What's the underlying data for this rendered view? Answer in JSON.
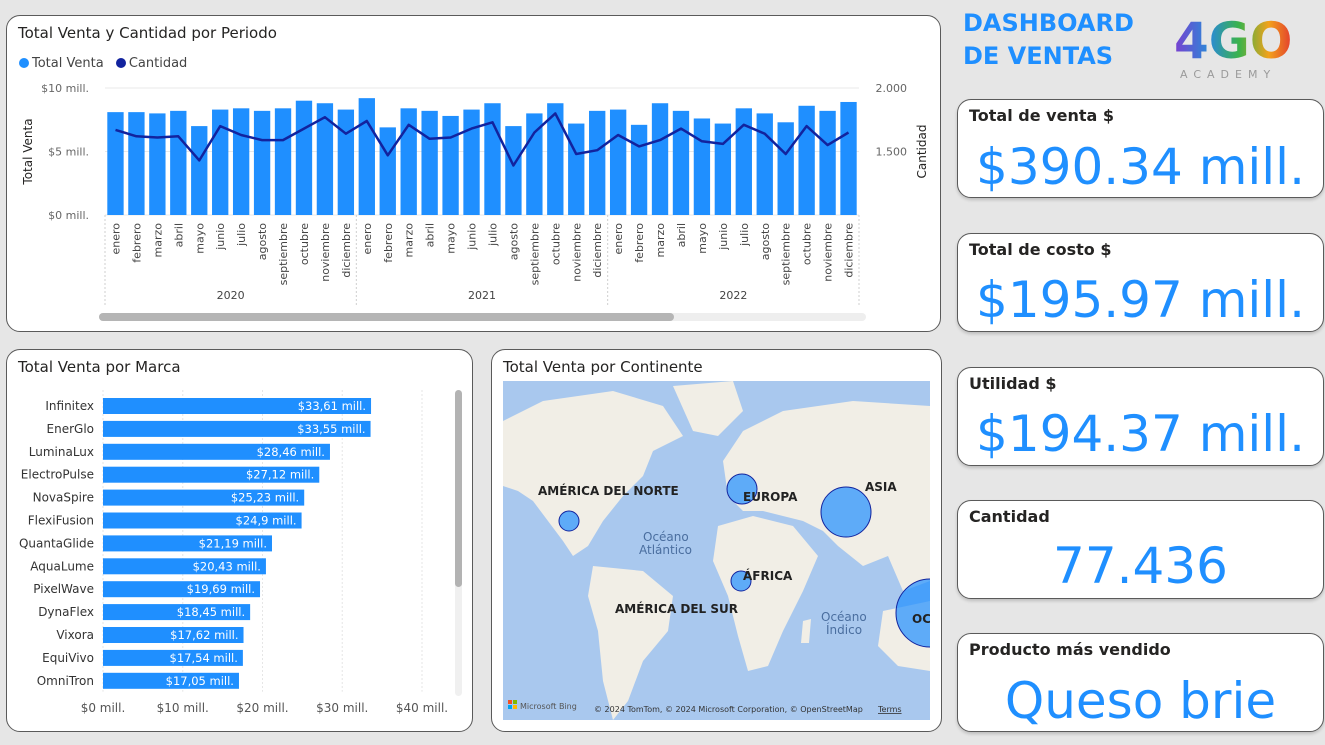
{
  "header": {
    "title_line1": "DASHBOARD",
    "title_line2": "DE VENTAS",
    "logo_text": "4GO",
    "logo_sub": "ACADEMY"
  },
  "colors": {
    "accent": "#1f8fff",
    "line": "#12239e"
  },
  "combo": {
    "title": "Total Venta y Cantidad por Periodo",
    "legend": [
      "Total Venta",
      "Cantidad"
    ]
  },
  "chart_data": [
    {
      "type": "bar+line",
      "title": "Total Venta y Cantidad por Periodo",
      "ylabel": "Total Venta",
      "y2label": "Cantidad",
      "ylim": [
        0,
        10
      ],
      "y2lim": [
        1000,
        2000
      ],
      "yticks": [
        "$0 mill.",
        "$5 mill.",
        "$10 mill."
      ],
      "y2ticks": [
        "1.500",
        "2.000"
      ],
      "years": [
        "2020",
        "2021",
        "2022"
      ],
      "months": [
        "enero",
        "febrero",
        "marzo",
        "abril",
        "mayo",
        "junio",
        "julio",
        "agosto",
        "septiembre",
        "octubre",
        "noviembre",
        "diciembre"
      ],
      "series": [
        {
          "name": "Total Venta",
          "values": [
            8.1,
            8.1,
            8.0,
            8.2,
            7.0,
            8.3,
            8.4,
            8.2,
            8.4,
            9.0,
            8.8,
            8.3,
            9.2,
            6.9,
            8.4,
            8.2,
            7.8,
            8.3,
            8.8,
            7.0,
            8.0,
            8.8,
            7.2,
            8.2,
            8.3,
            7.1,
            8.8,
            8.2,
            7.6,
            7.2,
            8.4,
            8.0,
            7.3,
            8.6,
            8.2,
            8.9
          ]
        },
        {
          "name": "Cantidad",
          "values": [
            1670,
            1620,
            1610,
            1620,
            1430,
            1700,
            1630,
            1590,
            1590,
            1680,
            1770,
            1640,
            1740,
            1470,
            1710,
            1600,
            1610,
            1680,
            1730,
            1390,
            1650,
            1800,
            1480,
            1510,
            1630,
            1540,
            1590,
            1680,
            1580,
            1560,
            1710,
            1640,
            1480,
            1700,
            1550,
            1650
          ]
        }
      ]
    },
    {
      "type": "bar",
      "title": "Total Venta por Marca",
      "categories": [
        "Infinitex",
        "EnerGlo",
        "LuminaLux",
        "ElectroPulse",
        "NovaSpire",
        "FlexiFusion",
        "QuantaGlide",
        "AquaLume",
        "PixelWave",
        "DynaFlex",
        "Vixora",
        "EquiVivo",
        "OmniTron"
      ],
      "values": [
        33.61,
        33.55,
        28.46,
        27.12,
        25.23,
        24.9,
        21.19,
        20.43,
        19.69,
        18.45,
        17.62,
        17.54,
        17.05
      ],
      "labels": [
        "$33,61 mill.",
        "$33,55 mill.",
        "$28,46 mill.",
        "$27,12 mill.",
        "$25,23 mill.",
        "$24,9 mill.",
        "$21,19 mill.",
        "$20,43 mill.",
        "$19,69 mill.",
        "$18,45 mill.",
        "$17,62 mill.",
        "$17,54 mill.",
        "$17,05 mill."
      ],
      "xlim": [
        0,
        40
      ],
      "xticks": [
        "$0 mill.",
        "$10 mill.",
        "$20 mill.",
        "$30 mill.",
        "$40 mill."
      ]
    }
  ],
  "brands": {
    "title": "Total Venta por Marca"
  },
  "map": {
    "title": "Total Venta por Continente",
    "labels": {
      "na": "AMÉRICA DEL NORTE",
      "eu": "EUROPA",
      "as": "ASIA",
      "af": "ÁFRICA",
      "sa": "AMÉRICA DEL SUR",
      "oc": "OCE"
    },
    "oceans": {
      "atl1": "Océano",
      "atl2": "Atlántico",
      "ind1": "Océano",
      "ind2": "Índico"
    },
    "footer_brand": "Microsoft Bing",
    "copyright": "© 2024 TomTom, © 2024 Microsoft Corporation, © OpenStreetMap",
    "terms": "Terms"
  },
  "kpis": [
    {
      "title": "Total de venta $",
      "value": "$390.34 mill."
    },
    {
      "title": "Total de costo $",
      "value": "$195.97 mill."
    },
    {
      "title": "Utilidad $",
      "value": "$194.37 mill."
    },
    {
      "title": "Cantidad",
      "value": "77.436"
    },
    {
      "title": "Producto más vendido",
      "value": "Queso brie"
    }
  ]
}
